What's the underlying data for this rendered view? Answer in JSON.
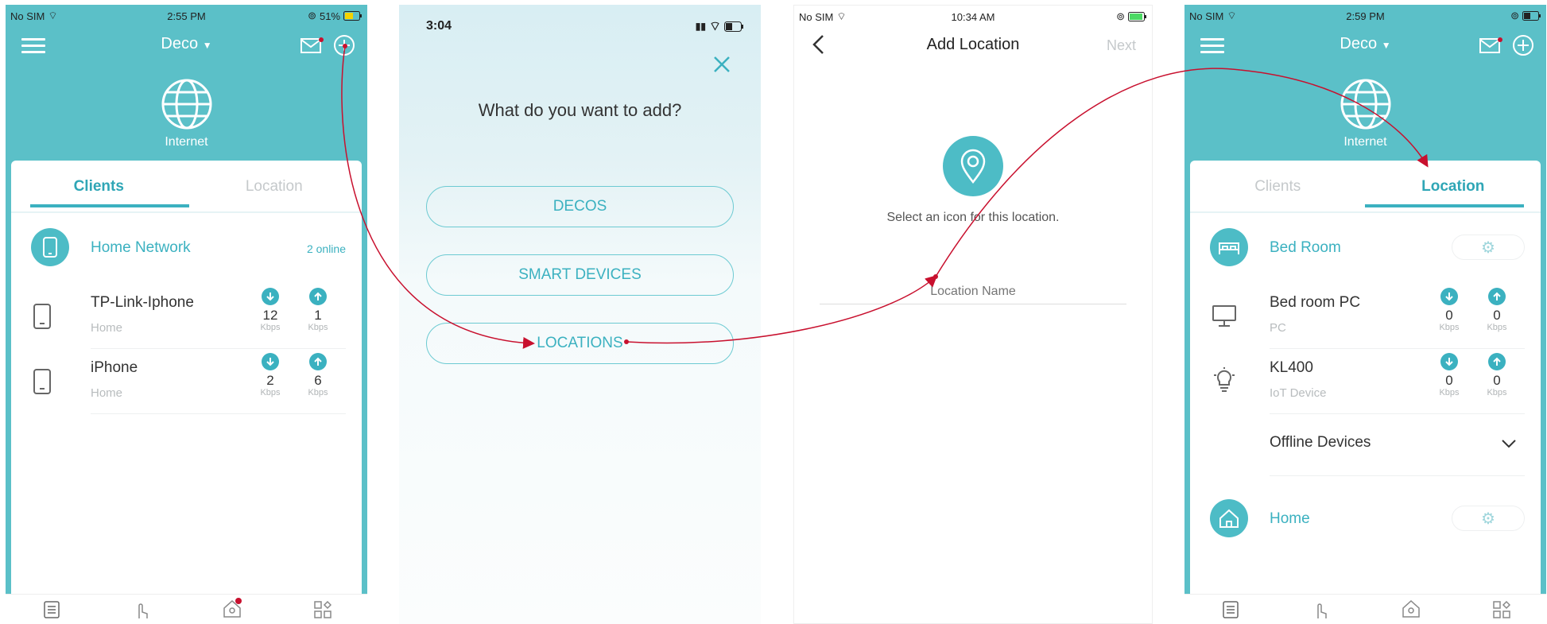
{
  "colors": {
    "accent": "#3bb1c0",
    "header_bg": "#5bc0c8",
    "arrow": "#c8102e"
  },
  "screen1": {
    "status": {
      "carrier": "No SIM",
      "time": "2:55 PM",
      "battery": "51%"
    },
    "title": "Deco",
    "internet_label": "Internet",
    "tabs": [
      "Clients",
      "Location"
    ],
    "network": {
      "name": "Home Network",
      "online": "2 online"
    },
    "devices": [
      {
        "name": "TP-Link-Iphone",
        "sub": "Home",
        "down": "12",
        "up": "1",
        "unit": "Kbps"
      },
      {
        "name": "iPhone",
        "sub": "Home",
        "down": "2",
        "up": "6",
        "unit": "Kbps"
      }
    ]
  },
  "screen2": {
    "status": {
      "time": "3:04"
    },
    "question": "What do you want to add?",
    "options": [
      "DECOS",
      "SMART DEVICES",
      "LOCATIONS"
    ]
  },
  "screen3": {
    "status": {
      "carrier": "No SIM",
      "time": "10:34 AM"
    },
    "title": "Add Location",
    "next": "Next",
    "hint": "Select an icon for this location.",
    "input_placeholder": "Location Name"
  },
  "screen4": {
    "status": {
      "carrier": "No SIM",
      "time": "2:59 PM"
    },
    "title": "Deco",
    "internet_label": "Internet",
    "tabs": [
      "Clients",
      "Location"
    ],
    "bedroom": "Bed Room",
    "devices": [
      {
        "name": "Bed room PC",
        "sub": "PC",
        "down": "0",
        "up": "0",
        "unit": "Kbps"
      },
      {
        "name": "KL400",
        "sub": "IoT Device",
        "down": "0",
        "up": "0",
        "unit": "Kbps"
      }
    ],
    "offline": "Offline Devices",
    "home": "Home"
  }
}
